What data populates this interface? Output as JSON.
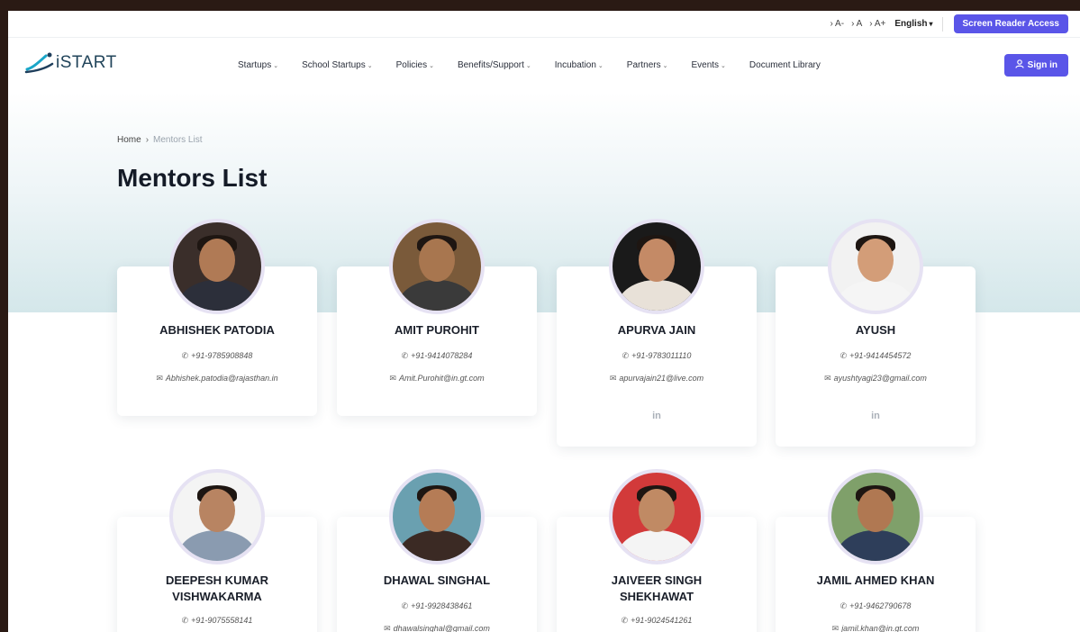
{
  "topbar": {
    "font_small": "› A-",
    "font_normal": "› A",
    "font_large": "› A+",
    "language": "English",
    "language_chevron": "▾",
    "screen_reader": "Screen Reader Access"
  },
  "logo": {
    "text": "iSTART"
  },
  "nav": {
    "items": [
      {
        "label": "Startups",
        "chev": "⌄"
      },
      {
        "label": "School Startups",
        "chev": "⌄"
      },
      {
        "label": "Policies",
        "chev": "⌄"
      },
      {
        "label": "Benefits/Support",
        "chev": "⌄"
      },
      {
        "label": "Incubation",
        "chev": "⌄"
      },
      {
        "label": "Partners",
        "chev": "⌄"
      },
      {
        "label": "Events",
        "chev": "⌄"
      },
      {
        "label": "Document Library",
        "chev": ""
      }
    ],
    "signin": "Sign in",
    "signin_icon": "user-icon"
  },
  "breadcrumb": {
    "home": "Home",
    "arrow": "›",
    "current": "Mentors List"
  },
  "page_title": "Mentors List",
  "icons": {
    "phone": "✆",
    "mail": "✉",
    "linkedin": "in"
  },
  "mentors": [
    {
      "name": "ABHISHEK PATODIA",
      "phone": "+91-9785908848",
      "email": "Abhishek.patodia@rajasthan.in",
      "linkedin": false,
      "photo_bg": "#3a2e2a",
      "skin": "#b07a55",
      "shirt": "#2c2f3a"
    },
    {
      "name": "AMIT PUROHIT",
      "phone": "+91-9414078284",
      "email": "Amit.Purohit@in.gt.com",
      "linkedin": false,
      "photo_bg": "#7a5a3a",
      "skin": "#a8764f",
      "shirt": "#3a3a3a"
    },
    {
      "name": "APURVA JAIN",
      "phone": "+91-9783011110",
      "email": "apurvajain21@live.com",
      "linkedin": true,
      "photo_bg": "#1a1a1a",
      "skin": "#c48a66",
      "shirt": "#e8e1d8"
    },
    {
      "name": "AYUSH",
      "phone": "+91-9414454572",
      "email": "ayushtyagi23@gmail.com",
      "linkedin": true,
      "photo_bg": "#f2f2f2",
      "skin": "#d39d78",
      "shirt": "#f5f5f5"
    },
    {
      "name": "DEEPESH KUMAR VISHWAKARMA",
      "phone": "+91-9075558141",
      "email": "",
      "linkedin": false,
      "photo_bg": "#f4f4f4",
      "skin": "#b88462",
      "shirt": "#8a9bb0"
    },
    {
      "name": "DHAWAL SINGHAL",
      "phone": "+91-9928438461",
      "email": "dhawalsinghal@gmail.com",
      "linkedin": false,
      "photo_bg": "#6aa0b0",
      "skin": "#b57c56",
      "shirt": "#3b2a24"
    },
    {
      "name": "JAIVEER SINGH SHEKHAWAT",
      "phone": "+91-9024541261",
      "email": "",
      "linkedin": false,
      "photo_bg": "#d23a3a",
      "skin": "#c08a64",
      "shirt": "#f4f4f4"
    },
    {
      "name": "JAMIL AHMED KHAN",
      "phone": "+91-9462790678",
      "email": "jamil.khan@in.gt.com",
      "linkedin": false,
      "photo_bg": "#7fa06a",
      "skin": "#b07852",
      "shirt": "#2e3e5a"
    }
  ]
}
